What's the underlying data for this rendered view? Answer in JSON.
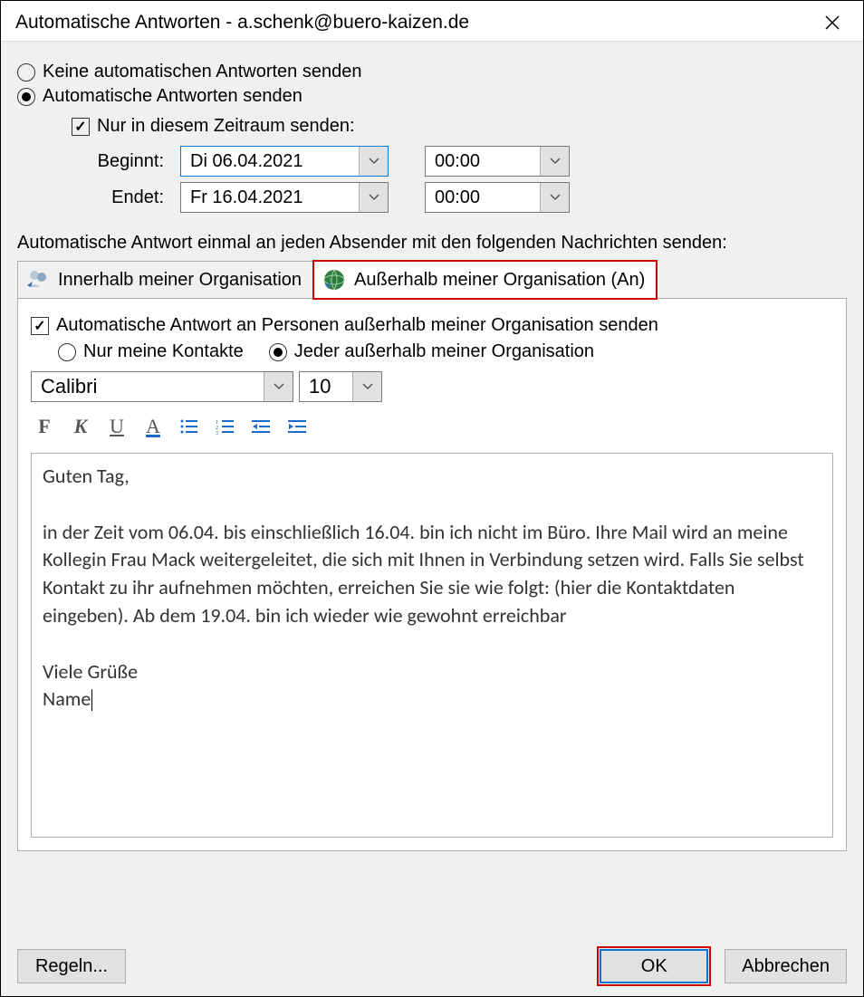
{
  "window": {
    "title": "Automatische Antworten - a.schenk@buero-kaizen.de"
  },
  "radios": {
    "no_send": "Keine automatischen Antworten senden",
    "send": "Automatische Antworten senden"
  },
  "timerange": {
    "checkbox_label": "Nur in diesem Zeitraum senden:",
    "start_label": "Beginnt:",
    "start_date": "Di 06.04.2021",
    "start_time": "00:00",
    "end_label": "Endet:",
    "end_date": "Fr 16.04.2021",
    "end_time": "00:00"
  },
  "section_label": "Automatische Antwort einmal an jeden Absender mit den folgenden Nachrichten senden:",
  "tabs": {
    "inside": "Innerhalb meiner Organisation",
    "outside": "Außerhalb meiner Organisation (An)"
  },
  "outside_tab": {
    "send_checkbox": "Automatische Antwort an Personen außerhalb meiner Organisation senden",
    "only_contacts": "Nur meine Kontakte",
    "everyone": "Jeder außerhalb meiner Organisation",
    "font_name": "Calibri",
    "font_size": "10",
    "message": "Guten Tag,\n\nin der Zeit vom 06.04. bis einschließlich 16.04. bin ich nicht im Büro. Ihre Mail wird an meine Kollegin Frau Mack weitergeleitet, die sich mit Ihnen in Verbindung setzen wird. Falls Sie selbst Kontakt zu ihr aufnehmen möchten, erreichen Sie sie wie folgt: (hier die Kontaktdaten eingeben). Ab dem 19.04. bin ich wieder wie gewohnt erreichbar\n\nViele Grüße\nName"
  },
  "format_buttons": {
    "bold": "F",
    "italic": "K",
    "underline": "U",
    "fontcolor": "A"
  },
  "footer": {
    "rules": "Regeln...",
    "ok": "OK",
    "cancel": "Abbrechen"
  }
}
